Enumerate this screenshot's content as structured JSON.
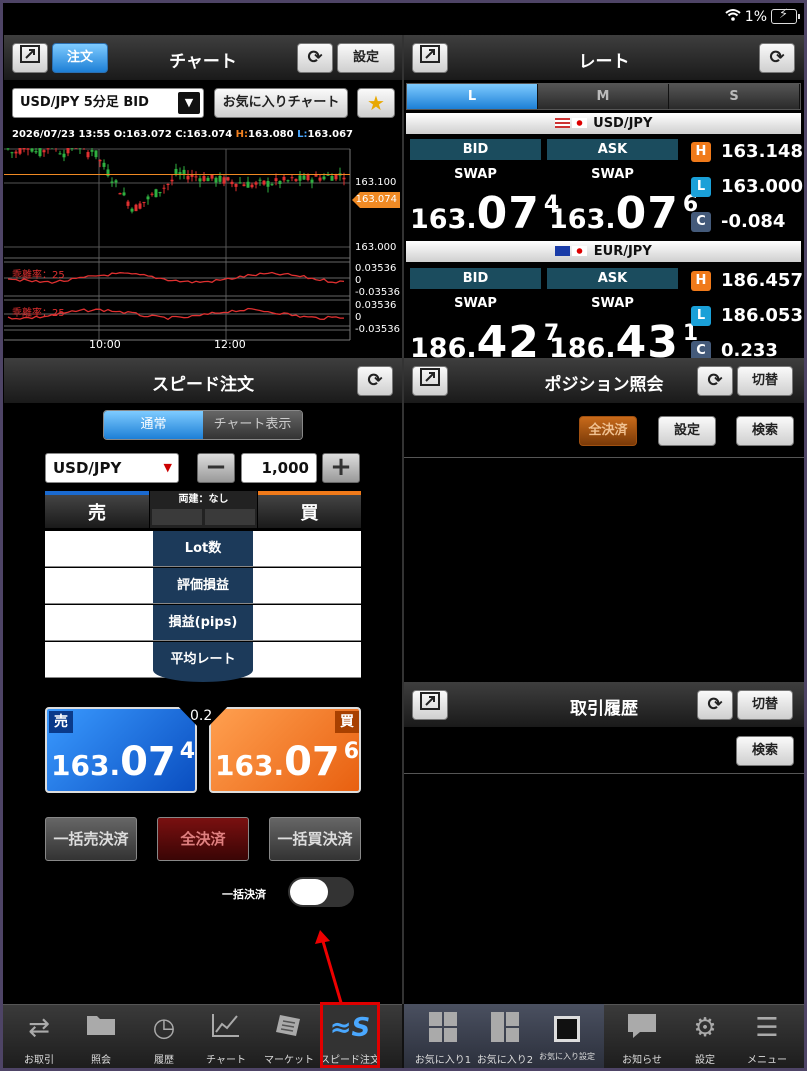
{
  "status": {
    "battery_pct": "1%"
  },
  "chart_panel": {
    "title": "チャート",
    "order_label": "注文",
    "settings_label": "設定",
    "symbol_select": "USD/JPY 5分足 BID",
    "favorite_chart_label": "お気に入りチャート",
    "ohlc_date": "2026/07/23 13:55",
    "o_label": "O:",
    "o_value": "163.072",
    "c_label": "C:",
    "c_value": "163.074",
    "h_label": "H:",
    "h_value": "163.080",
    "l_label": "L:",
    "l_value": "163.067",
    "y_top": "163.100",
    "y_current": "163.074",
    "y_bottom": "163.000",
    "ind1_label": "乖離率：25",
    "ind1_top": "0.03536",
    "ind1_mid": "0",
    "ind1_bot": "-0.03536",
    "ind2_label": "乖離率：25",
    "ind2_top": "0.03536",
    "ind2_mid": "0",
    "ind2_bot": "-0.03536",
    "x_tick1": "10:00",
    "x_tick2": "12:00"
  },
  "chart_data": {
    "type": "candlestick",
    "ylim": [
      163.0,
      163.1
    ],
    "current": 163.074,
    "x_ticks": [
      "10:00",
      "12:00"
    ]
  },
  "rate_panel": {
    "title": "レート",
    "tabs": [
      "L",
      "M",
      "S"
    ],
    "active_tab": "L",
    "pairs": [
      {
        "name": "USD/JPY",
        "bid_label": "BID",
        "ask_label": "ASK",
        "swap_label": "SWAP",
        "bid_small": "163.",
        "bid_big": "07",
        "bid_sup": "4",
        "ask_small": "163.",
        "ask_big": "07",
        "ask_sup": "6",
        "h": "163.148",
        "l": "163.000",
        "c": "-0.084"
      },
      {
        "name": "EUR/JPY",
        "bid_label": "BID",
        "ask_label": "ASK",
        "swap_label": "SWAP",
        "bid_small": "186.",
        "bid_big": "42",
        "bid_sup": "7",
        "ask_small": "186.",
        "ask_big": "43",
        "ask_sup": "1",
        "h": "186.457",
        "l": "186.053",
        "c": "0.233"
      }
    ],
    "h_badge": "H",
    "l_badge": "L",
    "c_badge": "C"
  },
  "speed_order": {
    "title": "スピード注文",
    "mode_normal": "通常",
    "mode_chart": "チャート表示",
    "symbol": "USD/JPY",
    "qty": "1,000",
    "sell_label": "売",
    "buy_label": "買",
    "hedge_label": "両建：なし",
    "rows": [
      "Lot数",
      "評価損益",
      "損益(pips)",
      "平均レート"
    ],
    "sell_tag": "売",
    "buy_tag": "買",
    "spread": "0.2",
    "sell_small": "163.",
    "sell_big": "07",
    "sell_sup": "4",
    "buy_small": "163.",
    "buy_big": "07",
    "buy_sup": "6",
    "bulk_sell_close": "一括売決済",
    "all_close": "全決済",
    "bulk_buy_close": "一括買決済",
    "bulk_toggle_label": "一括決済"
  },
  "position_panel": {
    "title": "ポジション照会",
    "switch_label": "切替",
    "all_close": "全決済",
    "settings": "設定",
    "search": "検索"
  },
  "history_panel": {
    "title": "取引履歴",
    "switch_label": "切替",
    "search": "検索"
  },
  "tabbar": {
    "items": [
      "お取引",
      "照会",
      "履歴",
      "チャート",
      "マーケット",
      "スピード注文",
      "お気に入り1",
      "お気に入り2",
      "お気に入り設定",
      "お知らせ",
      "設定",
      "メニュー"
    ],
    "active": "スピード注文"
  },
  "colors": {
    "accent_blue": "#1d7fd6",
    "sell_blue": "#0a66d6",
    "buy_orange": "#f07a1a",
    "annotation_red": "#e00000"
  }
}
